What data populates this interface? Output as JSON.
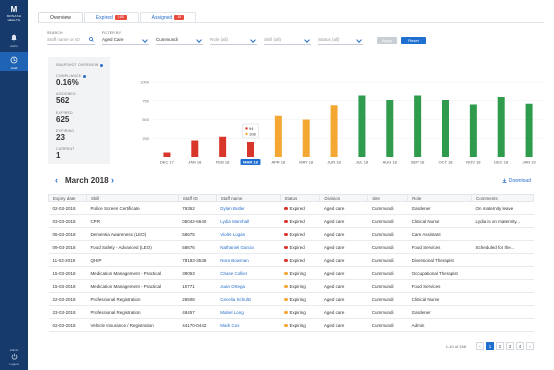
{
  "sidebar": {
    "logo_mark": "M",
    "logo_line1": "MONASH",
    "logo_line2": "HEALTH",
    "items": [
      {
        "label": "Alerts"
      },
      {
        "label": "Audit"
      }
    ],
    "bottom_label_top": "Admin",
    "bottom_label": "Logout"
  },
  "tabs": [
    {
      "label": "Overview",
      "badge": ""
    },
    {
      "label": "Expired",
      "badge": "165"
    },
    {
      "label": "Assigned",
      "badge": "15"
    }
  ],
  "filters": {
    "search_label": "SEARCH",
    "search_placeholder": "Staff name or ID",
    "filter_label": "FILTER BY",
    "division": "Aged Care",
    "site": "Cummundi",
    "role_placeholder": "Role (all)",
    "skill_placeholder": "Skill (all)",
    "status_placeholder": "Status (all)",
    "apply_label": "Apply",
    "reset_label": "Reset"
  },
  "overview": {
    "title": "SNAPSHOT OVERVIEW",
    "compliance_label": "COMPLIANCE",
    "compliance_value": "0.16%",
    "assigned_label": "ASSIGNED",
    "assigned_value": "562",
    "expired_label": "EXPIRED",
    "expired_value": "625",
    "expiring_label": "EXPIRING",
    "expiring_value": "23",
    "current_label": "CURRENT",
    "current_value": "1"
  },
  "colors": {
    "expired": "#d9362b",
    "expiring": "#f4a733",
    "current": "#2f9b4c",
    "accent": "#2a6fca",
    "sidebar": "#153a6b"
  },
  "chart_data": {
    "type": "bar",
    "categories": [
      "DEC 17",
      "JAN 18",
      "FEB 18",
      "MAR 18",
      "APR 18",
      "MAY 18",
      "JUN 18",
      "JUL 18",
      "AUG 18",
      "SEP 18",
      "OCT 18",
      "NOV 18",
      "DEC 18",
      "JAN 19"
    ],
    "selected_category": "MAR 18",
    "values": [
      60,
      220,
      270,
      200,
      550,
      500,
      690,
      820,
      760,
      820,
      760,
      700,
      800,
      710
    ],
    "bar_series": [
      "expired",
      "expired",
      "expired",
      "expired",
      "expiring",
      "expiring",
      "expiring",
      "current",
      "current",
      "current",
      "current",
      "current",
      "current",
      "current"
    ],
    "yticks": [
      250,
      500,
      750,
      1000
    ],
    "ylim": [
      0,
      1000
    ],
    "tooltip": {
      "expired": "94",
      "expiring": "108"
    },
    "title": "",
    "xlabel": "",
    "ylabel": ""
  },
  "month_nav": {
    "label": "March 2018",
    "download_label": "Download"
  },
  "table": {
    "headers": [
      "Expiry date",
      "Skill",
      "Staff ID",
      "Staff name",
      "Status",
      "Division",
      "Site",
      "Role",
      "Comments"
    ],
    "rows": [
      [
        "02-03-2018",
        "Police Screen Certificate",
        "76352",
        "Dylan Butler",
        "Expired",
        "Aged care",
        "Cummundi",
        "Gardener",
        "On maternity leave"
      ],
      [
        "03-03-2018",
        "CPR",
        "05042-6640",
        "Lydia Marshall",
        "Expired",
        "Aged care",
        "Cummundi",
        "Clinical Nurse",
        "Lydia is on maternity..."
      ],
      [
        "06-03-2018",
        "Dementia Awareness (LEO)",
        "58675",
        "Violet Logan",
        "Expired",
        "Aged care",
        "Cummundi",
        "Care Assistant",
        ""
      ],
      [
        "09-03-2018",
        "Food Safety - Advanced (LEO)",
        "58676",
        "Nathaniel Garcia",
        "Expired",
        "Aged care",
        "Cummundi",
        "Food Services",
        "Scheduled for the..."
      ],
      [
        "11-03-2018",
        "QHIP",
        "78183-3538",
        "Nora Bowman",
        "Expired",
        "Aged care",
        "Cummundi",
        "Diversional Therapist",
        ""
      ],
      [
        "15-03-2018",
        "Medication Management - Practical",
        "39053",
        "Chase Collier",
        "Expiring",
        "Aged care",
        "Cummundi",
        "Occupational Therapist",
        ""
      ],
      [
        "15-03-2018",
        "Medication Management - Practical",
        "10771",
        "Juan Ortega",
        "Expiring",
        "Aged care",
        "Cummundi",
        "Food Services",
        ""
      ],
      [
        "22-03-2018",
        "Professional Registration",
        "26508",
        "Cecelia Schultz",
        "Expiring",
        "Aged care",
        "Cummundi",
        "Clinical Nurse",
        ""
      ],
      [
        "23-03-2018",
        "Professional Registration",
        "48457",
        "Mabel Long",
        "Expiring",
        "Aged care",
        "Cummundi",
        "Gardener",
        ""
      ],
      [
        "02-03-2018",
        "Vehicle Insurance / Registration",
        "44170-0442",
        "Mark Cox",
        "Expiring",
        "Aged care",
        "Cummundi",
        "Admin",
        ""
      ]
    ]
  },
  "pagination": {
    "info": "1-10 of 156",
    "pages": [
      "1",
      "2",
      "3",
      "4"
    ],
    "prev": "‹",
    "next": "›",
    "active_page": "1"
  }
}
